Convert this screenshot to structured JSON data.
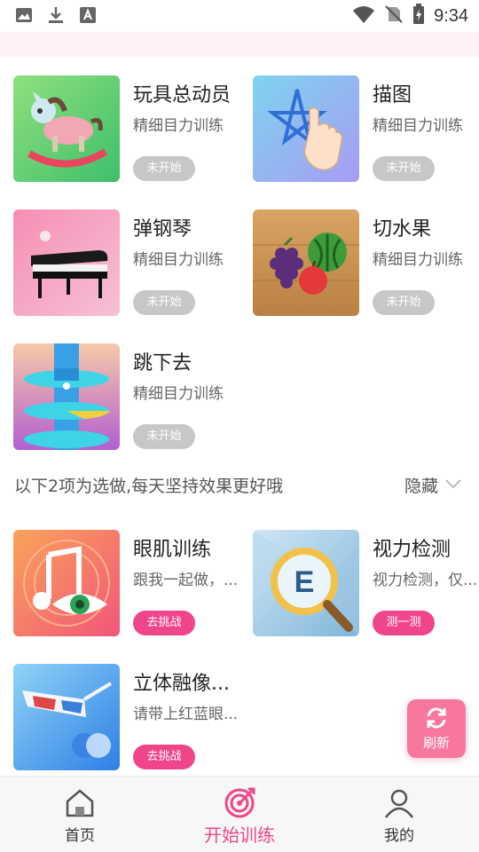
{
  "status_bar": {
    "time": "9:34",
    "left_icons": [
      "image-icon",
      "download-icon",
      "font-icon"
    ],
    "right_icons": [
      "wifi-icon",
      "no-sim-icon",
      "battery-charging-icon"
    ]
  },
  "games": [
    {
      "title": "玩具总动员",
      "subtitle": "精细目力训练",
      "button": "未开始",
      "icon": "rocking-horse-icon"
    },
    {
      "title": "描图",
      "subtitle": "精细目力训练",
      "button": "未开始",
      "icon": "star-trace-icon"
    },
    {
      "title": "弹钢琴",
      "subtitle": "精细目力训练",
      "button": "未开始",
      "icon": "piano-icon"
    },
    {
      "title": "切水果",
      "subtitle": "精细目力训练",
      "button": "未开始",
      "icon": "fruit-icon"
    },
    {
      "title": "跳下去",
      "subtitle": "精细目力训练",
      "button": "未开始",
      "icon": "helix-tower-icon"
    }
  ],
  "optional_section": {
    "text": "以下2项为选做,每天坚持效果更好哦",
    "toggle_label": "隐藏"
  },
  "optional_items": [
    {
      "title": "眼肌训练",
      "subtitle": "跟我一起做，...",
      "button": "去挑战",
      "icon": "music-eye-icon"
    },
    {
      "title": "视力检测",
      "subtitle": "视力检测，仅...",
      "button": "测一测",
      "icon": "magnifier-e-icon"
    },
    {
      "title": "立体融像...",
      "subtitle": "请带上红蓝眼...",
      "button": "去挑战",
      "icon": "3d-glasses-icon"
    }
  ],
  "refresh": {
    "label": "刷新"
  },
  "tabs": [
    {
      "label": "首页",
      "active": false
    },
    {
      "label": "开始训练",
      "active": true
    },
    {
      "label": "我的",
      "active": false
    }
  ],
  "colors": {
    "accent": "#f0458a",
    "button_inactive": "#c7c7c7",
    "refresh_bg": "#f7779d",
    "pink_strip": "#fdf0f6"
  }
}
